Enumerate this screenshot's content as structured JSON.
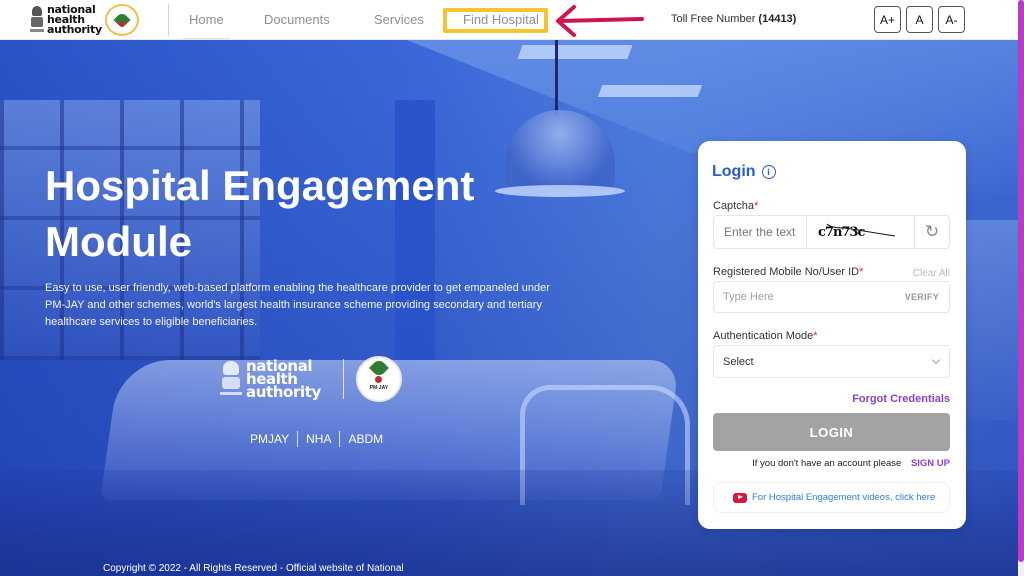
{
  "header": {
    "logo_text": [
      "national",
      "health",
      "authority"
    ],
    "logo_alt": "National Health Authority logo",
    "pmjay_logo_alt": "PM-JAY logo",
    "nav": [
      {
        "label": "Home"
      },
      {
        "label": "Documents"
      },
      {
        "label": "Services"
      },
      {
        "label": "Find Hospital"
      }
    ],
    "toll_free_label": "Toll Free Number",
    "toll_free_number": "(14413)",
    "font_buttons": [
      "A+",
      "A",
      "A-"
    ]
  },
  "annotation": {
    "highlight_target": "Find Hospital",
    "highlight_color": "#f5c52d",
    "arrow_color": "#d0144f"
  },
  "hero": {
    "title_line1": "Hospital Engagement",
    "title_line2": "Module",
    "description": "Easy to use, user friendly, web-based platform enabling the healthcare provider to get empaneled under PM-JAY and other schemes, world's largest health insurance scheme providing secondary and tertiary healthcare services to eligible beneficiaries.",
    "logo_text": [
      "national",
      "health",
      "authority"
    ],
    "pmjay_label": "PM-JAY",
    "links": [
      "PMJAY",
      "NHA",
      "ABDM"
    ],
    "copyright": "Copyright © 2022 - All Rights Reserved - Official website of National"
  },
  "login": {
    "title": "Login",
    "captcha_label": "Captcha",
    "captcha_placeholder": "Enter the text",
    "captcha_value": "c7n73c",
    "mobile_label": "Registered Mobile No/User ID",
    "clear_all": "Clear All",
    "mobile_placeholder": "Type Here",
    "verify": "VERIFY",
    "auth_label": "Authentication Mode",
    "auth_selected": "Select",
    "forgot": "Forgot Credentials",
    "login_button": "LOGIN",
    "no_account_text": "If you don't have an account please",
    "signup": "SIGN UP",
    "video_link": "For Hospital Engagement videos, click here",
    "required_mark": "*"
  },
  "colors": {
    "brand_blue": "#2a5bd7",
    "accent_purple": "#8e3fd0",
    "login_disabled": "#a3a3a3",
    "scrollbar": "#b73ec4"
  }
}
